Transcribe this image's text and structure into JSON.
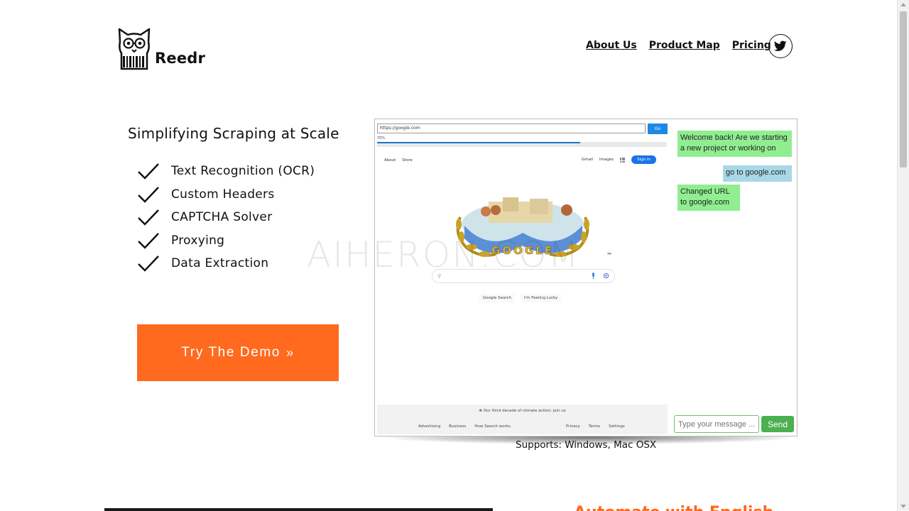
{
  "brand": {
    "name": "Reedr"
  },
  "nav": {
    "items": [
      {
        "label": "About Us"
      },
      {
        "label": "Product Map"
      },
      {
        "label": "Pricing"
      }
    ],
    "twitter_icon": "twitter-bird-icon"
  },
  "hero": {
    "title": "Simplifying Scraping at Scale",
    "features": [
      "Text Recognition (OCR)",
      "Custom Headers",
      "CAPTCHA Solver",
      "Proxying",
      "Data Extraction"
    ],
    "cta_label": "Try The Demo",
    "cta_icon": "double-chevron-right-icon",
    "accent_color": "#ff6a1f"
  },
  "preview": {
    "browser": {
      "url": "https://google.com",
      "go_label": "Go",
      "progress_label": "70%",
      "progress": 0.7,
      "google": {
        "top_left": [
          "About",
          "Store"
        ],
        "top_right": [
          "Gmail",
          "Images"
        ],
        "sign_in": "Sign in",
        "doodle_text": "GOOGLE",
        "buttons": [
          "Google Search",
          "I'm Feeling Lucky"
        ],
        "climate_text": "Our third decade of climate action: join us",
        "footer_left": [
          "Advertising",
          "Business",
          "How Search works"
        ],
        "footer_right": [
          "Privacy",
          "Terms",
          "Settings"
        ]
      }
    },
    "chat": {
      "messages": [
        {
          "role": "bot",
          "text": "Welcome back! Are we starting a new project or working on"
        },
        {
          "role": "user",
          "text": "go to google.com"
        },
        {
          "role": "bot",
          "text": "Changed URL to google.com"
        }
      ],
      "input_placeholder": "Type your message ...",
      "send_label": "Send",
      "bot_color": "#90ee90",
      "user_color": "#a8d8e6",
      "send_color": "#4caf50"
    }
  },
  "supports": "Supports: Windows, Mac OSX",
  "watermark": "AIHERON.COM",
  "bottom_heading": "Automate with English"
}
